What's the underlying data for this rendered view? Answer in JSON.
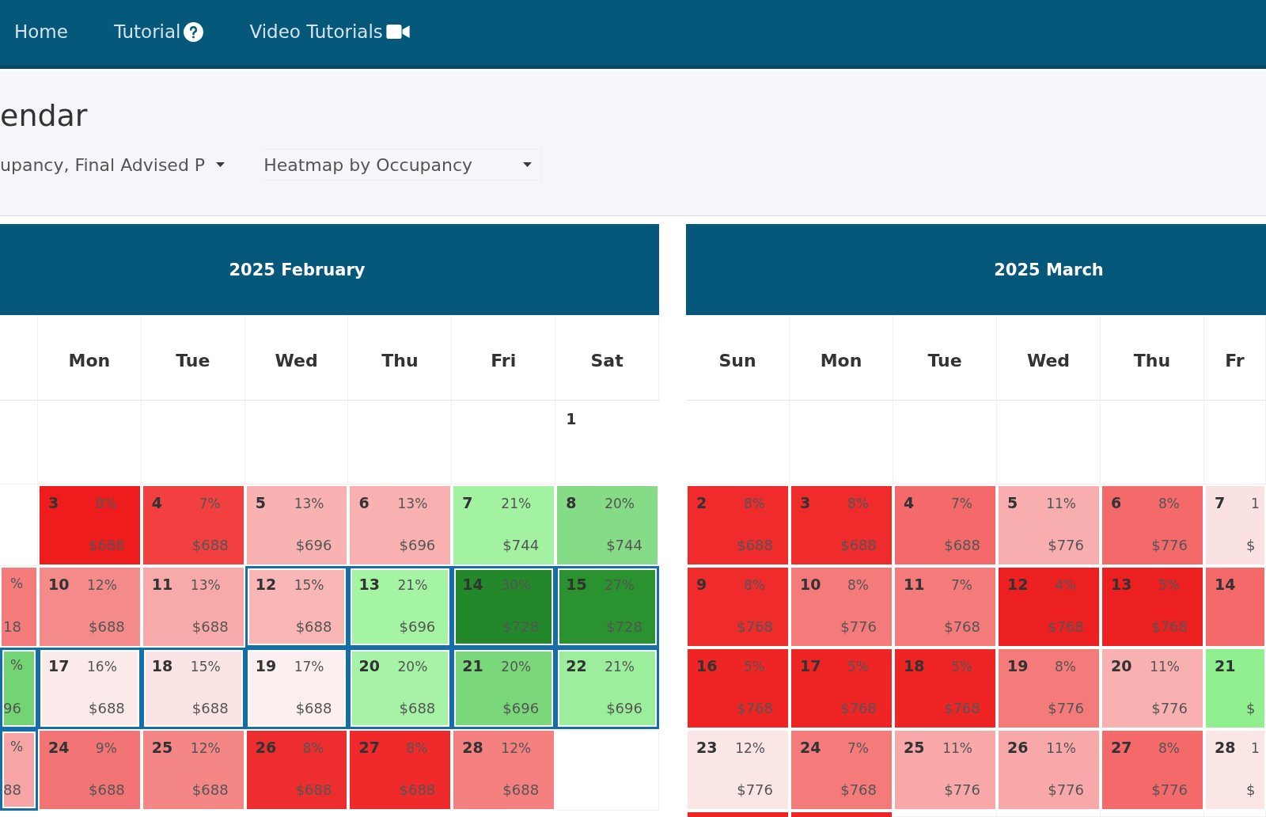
{
  "nav": {
    "items": [
      {
        "label": "Home"
      },
      {
        "label": "Tutorial"
      },
      {
        "label": "Video Tutorials"
      }
    ]
  },
  "page": {
    "title": "endar"
  },
  "filters": [
    {
      "kind": "dropdown",
      "value": "upancy, Final Advised P"
    },
    {
      "kind": "select",
      "value": "Heatmap by Occupancy"
    }
  ],
  "months": [
    {
      "title": "2025 February",
      "weekdays": [
        "Mon",
        "Tue",
        "Wed",
        "Thu",
        "Fri",
        "Sat"
      ],
      "weeks": [
        [
          {
            "kind": "empty"
          },
          {
            "kind": "empty"
          },
          {
            "kind": "empty"
          },
          {
            "kind": "empty"
          },
          {
            "kind": "empty"
          },
          {
            "kind": "empty"
          },
          {
            "kind": "day",
            "day": "1",
            "selected": false
          }
        ],
        [
          {
            "kind": "empty"
          },
          {
            "kind": "day",
            "day": "3",
            "occupancy": "8%",
            "price": "$688",
            "color": "#ee1c1c",
            "selected": false
          },
          {
            "kind": "day",
            "day": "4",
            "occupancy": "7%",
            "price": "$688",
            "color": "#f24040",
            "selected": false
          },
          {
            "kind": "day",
            "day": "5",
            "occupancy": "13%",
            "price": "$696",
            "color": "#f8b2b2",
            "selected": false
          },
          {
            "kind": "day",
            "day": "6",
            "occupancy": "13%",
            "price": "$696",
            "color": "#f8b0b0",
            "selected": false
          },
          {
            "kind": "day",
            "day": "7",
            "occupancy": "21%",
            "price": "$744",
            "color": "#a2f2a2",
            "selected": false
          },
          {
            "kind": "day",
            "day": "8",
            "occupancy": "20%",
            "price": "$744",
            "color": "#86dc86",
            "selected": false
          }
        ],
        [
          {
            "kind": "day",
            "occupancy": "%",
            "price": "18",
            "color": "#f47c7c",
            "selected": false
          },
          {
            "kind": "day",
            "day": "10",
            "occupancy": "12%",
            "price": "$688",
            "color": "#f58a8a",
            "selected": false
          },
          {
            "kind": "day",
            "day": "11",
            "occupancy": "13%",
            "price": "$688",
            "color": "#f8aaaa",
            "selected": false
          },
          {
            "kind": "day",
            "day": "12",
            "occupancy": "15%",
            "price": "$688",
            "color": "#f8b6b6",
            "selected": true
          },
          {
            "kind": "day",
            "day": "13",
            "occupancy": "21%",
            "price": "$696",
            "color": "#a4f4a4",
            "selected": true
          },
          {
            "kind": "day",
            "day": "14",
            "occupancy": "30%",
            "price": "$728",
            "color": "#22882a",
            "selected": true
          },
          {
            "kind": "day",
            "day": "15",
            "occupancy": "27%",
            "price": "$728",
            "color": "#2a922e",
            "selected": true
          }
        ],
        [
          {
            "kind": "day",
            "occupancy": "%",
            "price": "96",
            "color": "#72d472",
            "selected": true
          },
          {
            "kind": "day",
            "day": "17",
            "occupancy": "16%",
            "price": "$688",
            "color": "#fbeaea",
            "selected": true
          },
          {
            "kind": "day",
            "day": "18",
            "occupancy": "15%",
            "price": "$688",
            "color": "#fae4e4",
            "selected": true
          },
          {
            "kind": "day",
            "day": "19",
            "occupancy": "17%",
            "price": "$688",
            "color": "#fcefef",
            "selected": true
          },
          {
            "kind": "day",
            "day": "20",
            "occupancy": "20%",
            "price": "$688",
            "color": "#a6f2a6",
            "selected": true
          },
          {
            "kind": "day",
            "day": "21",
            "occupancy": "20%",
            "price": "$696",
            "color": "#7ad87a",
            "selected": true
          },
          {
            "kind": "day",
            "day": "22",
            "occupancy": "21%",
            "price": "$696",
            "color": "#9cee9c",
            "selected": true
          }
        ],
        [
          {
            "kind": "day",
            "occupancy": "%",
            "price": "88",
            "color": "#f6a4a4",
            "selected": true
          },
          {
            "kind": "day",
            "day": "24",
            "occupancy": "9%",
            "price": "$688",
            "color": "#f27474",
            "selected": false
          },
          {
            "kind": "day",
            "day": "25",
            "occupancy": "12%",
            "price": "$688",
            "color": "#f58686",
            "selected": false
          },
          {
            "kind": "day",
            "day": "26",
            "occupancy": "8%",
            "price": "$688",
            "color": "#ee2e2e",
            "selected": false
          },
          {
            "kind": "day",
            "day": "27",
            "occupancy": "8%",
            "price": "$688",
            "color": "#f02a2a",
            "selected": false
          },
          {
            "kind": "day",
            "day": "28",
            "occupancy": "12%",
            "price": "$688",
            "color": "#f58080",
            "selected": false
          },
          {
            "kind": "empty"
          }
        ]
      ]
    },
    {
      "title": "2025 March",
      "weekdays": [
        "Sun",
        "Mon",
        "Tue",
        "Wed",
        "Thu",
        "Fr"
      ],
      "weeks": [
        [
          {
            "kind": "empty"
          },
          {
            "kind": "empty"
          },
          {
            "kind": "empty"
          },
          {
            "kind": "empty"
          },
          {
            "kind": "empty"
          },
          {
            "kind": "empty"
          }
        ],
        [
          {
            "kind": "day",
            "day": "2",
            "occupancy": "8%",
            "price": "$688",
            "color": "#ef2b2b",
            "selected": false
          },
          {
            "kind": "day",
            "day": "3",
            "occupancy": "8%",
            "price": "$688",
            "color": "#ef2b2b",
            "selected": false
          },
          {
            "kind": "day",
            "day": "4",
            "occupancy": "7%",
            "price": "$688",
            "color": "#f46a6a",
            "selected": false
          },
          {
            "kind": "day",
            "day": "5",
            "occupancy": "11%",
            "price": "$776",
            "color": "#f8aeae",
            "selected": false
          },
          {
            "kind": "day",
            "day": "6",
            "occupancy": "8%",
            "price": "$776",
            "color": "#f46a6a",
            "selected": false
          },
          {
            "kind": "day",
            "day": "7",
            "occupancy": "1",
            "price": "$",
            "color": "#fbe2e2",
            "selected": false
          }
        ],
        [
          {
            "kind": "day",
            "day": "9",
            "occupancy": "8%",
            "price": "$768",
            "color": "#ef2b2b",
            "selected": false
          },
          {
            "kind": "day",
            "day": "10",
            "occupancy": "8%",
            "price": "$776",
            "color": "#f57a7a",
            "selected": false
          },
          {
            "kind": "day",
            "day": "11",
            "occupancy": "7%",
            "price": "$768",
            "color": "#f57a7a",
            "selected": false
          },
          {
            "kind": "day",
            "day": "12",
            "occupancy": "4%",
            "price": "$768",
            "color": "#ec2020",
            "selected": false
          },
          {
            "kind": "day",
            "day": "13",
            "occupancy": "5%",
            "price": "$768",
            "color": "#ec2020",
            "selected": false
          },
          {
            "kind": "day",
            "day": "14",
            "color": "#f46a6a",
            "selected": false
          }
        ],
        [
          {
            "kind": "day",
            "day": "16",
            "occupancy": "5%",
            "price": "$768",
            "color": "#ef2525",
            "selected": false
          },
          {
            "kind": "day",
            "day": "17",
            "occupancy": "5%",
            "price": "$768",
            "color": "#ef2525",
            "selected": false
          },
          {
            "kind": "day",
            "day": "18",
            "occupancy": "5%",
            "price": "$768",
            "color": "#ef2525",
            "selected": false
          },
          {
            "kind": "day",
            "day": "19",
            "occupancy": "8%",
            "price": "$776",
            "color": "#f57a7a",
            "selected": false
          },
          {
            "kind": "day",
            "day": "20",
            "occupancy": "11%",
            "price": "$776",
            "color": "#f8b0b0",
            "selected": false
          },
          {
            "kind": "day",
            "day": "21",
            "price": "$",
            "color": "#90f090",
            "selected": false
          }
        ],
        [
          {
            "kind": "day",
            "day": "23",
            "occupancy": "12%",
            "price": "$776",
            "color": "#fbe6e6",
            "selected": false
          },
          {
            "kind": "day",
            "day": "24",
            "occupancy": "7%",
            "price": "$768",
            "color": "#f57a7a",
            "selected": false
          },
          {
            "kind": "day",
            "day": "25",
            "occupancy": "11%",
            "price": "$776",
            "color": "#f8a8a8",
            "selected": false
          },
          {
            "kind": "day",
            "day": "26",
            "occupancy": "11%",
            "price": "$776",
            "color": "#f8a8a8",
            "selected": false
          },
          {
            "kind": "day",
            "day": "27",
            "occupancy": "8%",
            "price": "$776",
            "color": "#f46a6a",
            "selected": false
          },
          {
            "kind": "day",
            "day": "28",
            "occupancy": "1",
            "price": "$",
            "color": "#fbe6e6",
            "selected": false
          }
        ],
        [
          {
            "kind": "day",
            "color": "#ef2525",
            "selected": false
          },
          {
            "kind": "day",
            "color": "#ef2525",
            "selected": false
          },
          {
            "kind": "empty"
          },
          {
            "kind": "empty"
          },
          {
            "kind": "empty"
          },
          {
            "kind": "empty"
          }
        ]
      ]
    }
  ]
}
